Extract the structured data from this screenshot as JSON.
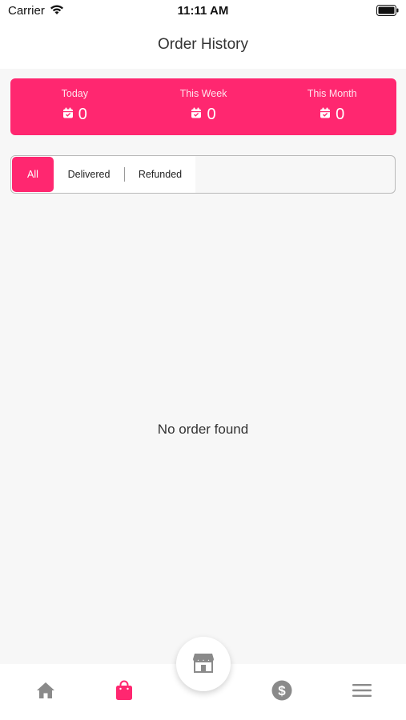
{
  "status_bar": {
    "carrier": "Carrier",
    "time": "11:11 AM"
  },
  "header": {
    "title": "Order History"
  },
  "stats": {
    "items": [
      {
        "label": "Today",
        "value": "0",
        "icon": "calendar-icon"
      },
      {
        "label": "This Week",
        "value": "0",
        "icon": "calendar-icon"
      },
      {
        "label": "This Month",
        "value": "0",
        "icon": "calendar-icon"
      }
    ]
  },
  "filters": {
    "tabs": [
      {
        "label": "All",
        "active": true
      },
      {
        "label": "Delivered",
        "active": false
      },
      {
        "label": "Refunded",
        "active": false
      }
    ]
  },
  "main": {
    "empty_message": "No order found"
  },
  "bottom_nav": {
    "items": [
      {
        "name": "home",
        "icon": "home-icon",
        "active": false
      },
      {
        "name": "orders",
        "icon": "shopping-bag-icon",
        "active": true
      },
      {
        "name": "store",
        "icon": "store-icon",
        "active": false
      },
      {
        "name": "earnings",
        "icon": "dollar-icon",
        "active": false
      },
      {
        "name": "menu",
        "icon": "menu-icon",
        "active": false
      }
    ]
  },
  "colors": {
    "accent": "#ff2770",
    "inactive_icon": "#8a8a8a",
    "background": "#f7f7f7"
  }
}
